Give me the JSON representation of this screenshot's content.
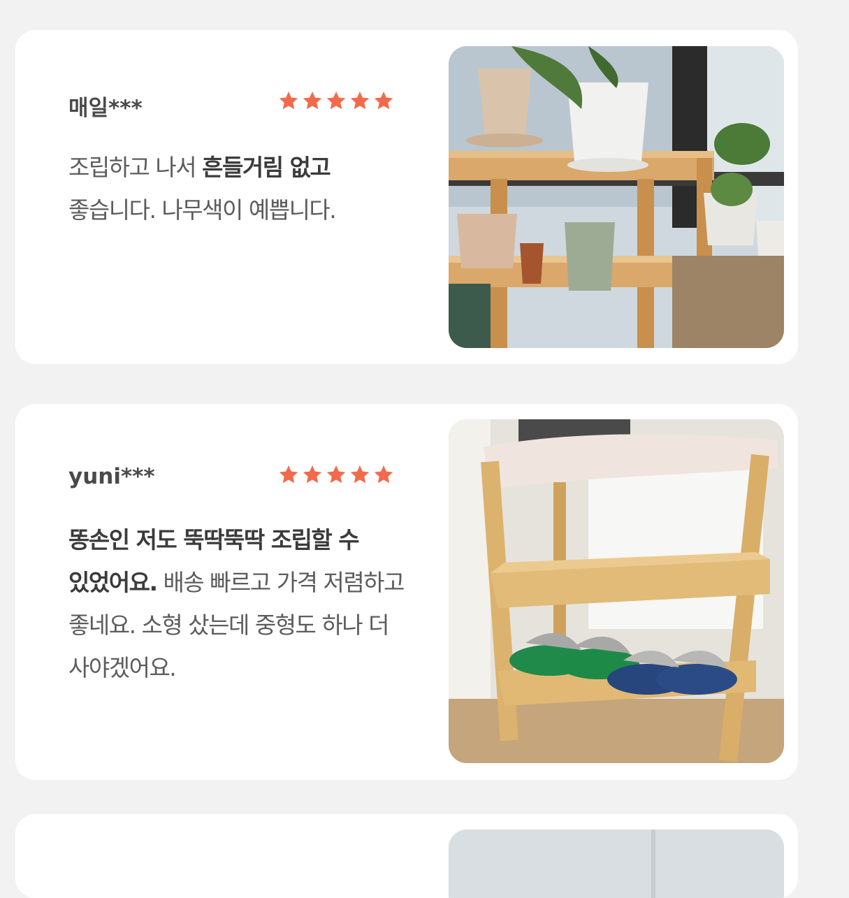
{
  "accent_color": "#f26a4b",
  "reviews": [
    {
      "reviewer": "매일***",
      "rating": 5,
      "text_parts": [
        "조립하고 나서 ",
        "흔들거림 없고",
        " 좋습니다. 나무색이 예쁩니다."
      ],
      "photo": "plant-shelf-photo"
    },
    {
      "reviewer": "yuni***",
      "rating": 5,
      "text_parts": [
        "똥손인 저도 뚝딱뚝딱 조립할 수 있었어요.",
        " 배송 빠르고 가격 저렴하고 좋네요. 소형 샀는데 중형도 하나 더 사야겠어요."
      ],
      "photo": "shoe-rack-photo"
    },
    {
      "photo": "partial-photo"
    }
  ]
}
